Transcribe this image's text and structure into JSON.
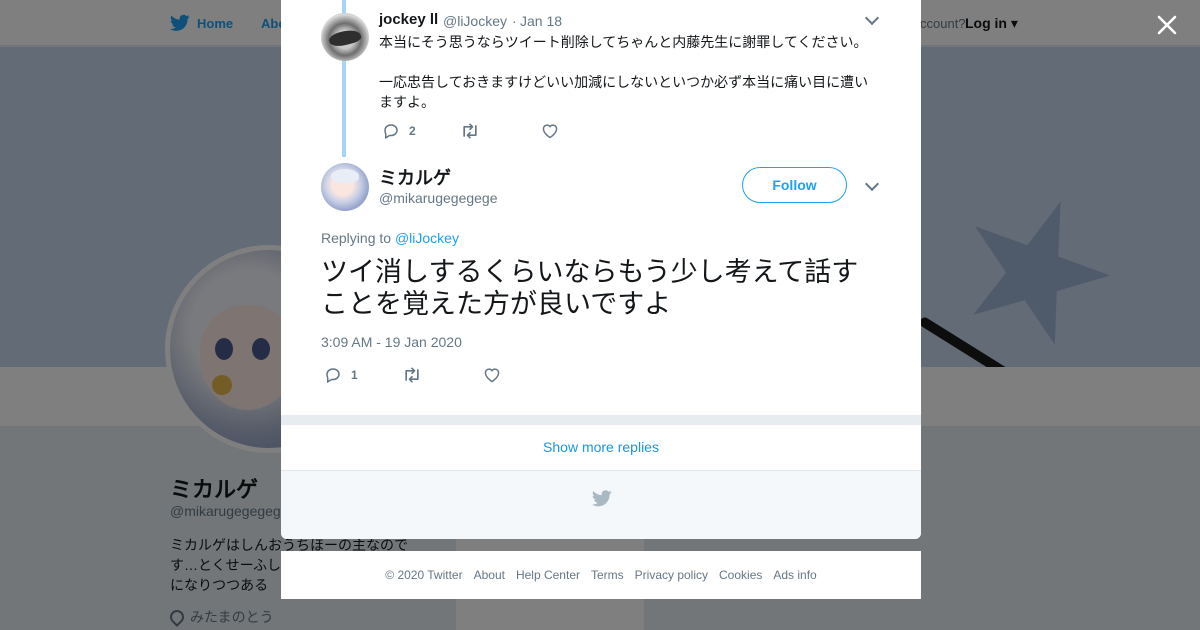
{
  "background_page": {
    "nav": {
      "home_label": "Home",
      "about_label": "Abo",
      "account_prompt": "ccount?",
      "login_label": "Log in"
    },
    "profile": {
      "display_name": "ミカルゲ",
      "handle": "@mikarugegegege",
      "bio_line1": "ミカルゲはしんおうちほーの主なので",
      "bio_line2": "す…とくせーふし",
      "bio_line3": "になりつつある",
      "location": "みたまのとう"
    },
    "side_card_text": "Ads info"
  },
  "reply_tweet": {
    "author_name": "jockey ll",
    "author_handle": "@liJockey",
    "separator": "·",
    "date": "Jan 18",
    "text_line1": "本当にそう思うならツイート削除してちゃんと内藤先生に謝罪してください。",
    "text_line2": "一応忠告しておきますけどいい加減にしないといつか必ず本当に痛い目に遭い",
    "text_line3": "ますよ。",
    "reply_count": "2",
    "icons": {
      "reply": "reply-icon",
      "retweet": "retweet-icon",
      "like": "like-icon",
      "more": "chevron-down-icon"
    }
  },
  "main_tweet": {
    "author_name": "ミカルゲ",
    "author_handle": "@mikarugegegege",
    "follow_label": "Follow",
    "replying_prefix": "Replying to",
    "replying_mention": "@liJockey",
    "text": "ツイ消しするくらいならもう少し考えて話すことを覚えた方が良いですよ",
    "timestamp": "3:09 AM - 19 Jan 2020",
    "reply_count": "1"
  },
  "show_more_label": "Show more replies",
  "footer": {
    "copyright": "© 2020 Twitter",
    "links": [
      "About",
      "Help Center",
      "Terms",
      "Privacy policy",
      "Cookies",
      "Ads info"
    ]
  },
  "colors": {
    "accent": "#1da1f2",
    "link": "#1b95e0",
    "text_primary": "#14171a",
    "text_secondary": "#657786",
    "thread_line": "#a6d5f7"
  }
}
